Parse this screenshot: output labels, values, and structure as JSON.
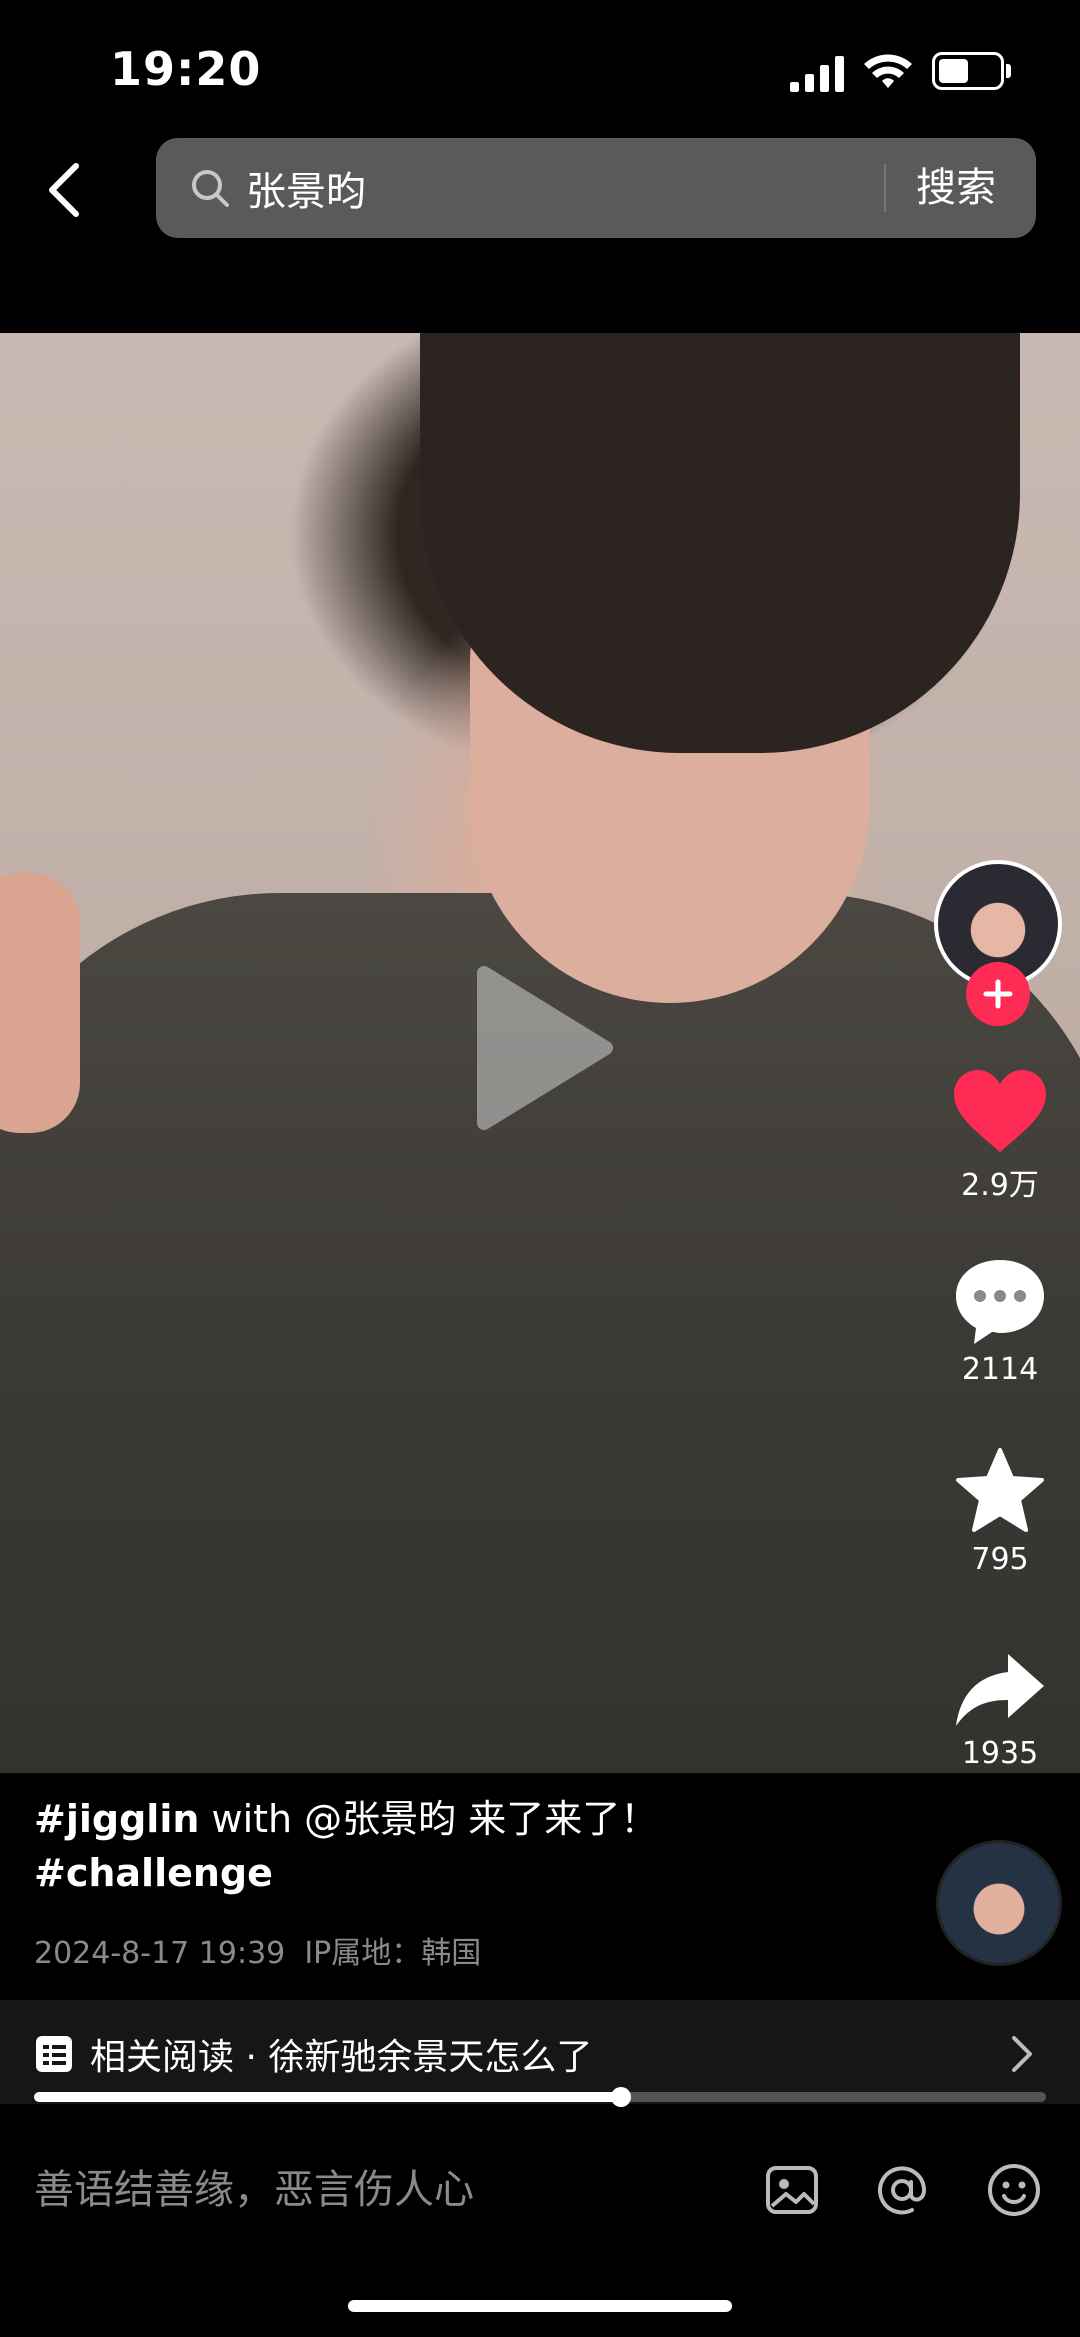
{
  "status_bar": {
    "time": "19:20",
    "battery_level": 0.5,
    "icons": [
      "signal-icon",
      "wifi-icon",
      "battery-icon"
    ]
  },
  "header": {
    "back_icon": "chevron-left-icon",
    "search_icon": "search-icon",
    "search_query": "张景昀",
    "search_button": "搜索"
  },
  "video": {
    "play_icon": "play-icon"
  },
  "actions": {
    "follow_icon": "plus-icon",
    "likes": "2.9万",
    "comments": "2114",
    "favorites": "795",
    "shares": "1935",
    "like_color": "#fe2c55"
  },
  "caption": {
    "tag1": "#jigglin",
    "text": " with @张景昀 来了来了！",
    "tag2": "#challenge",
    "date": "2024-8-17 19:39",
    "ip_location": "IP属地：韩国"
  },
  "related": {
    "icon": "document-icon",
    "text": "相关阅读 · 徐新驰余景天怎么了",
    "chevron": "chevron-right-icon",
    "progress": 0.58
  },
  "comment_bar": {
    "placeholder": "善语结善缘，恶言伤人心",
    "icons": [
      "image-icon",
      "at-icon",
      "emoji-icon"
    ]
  }
}
